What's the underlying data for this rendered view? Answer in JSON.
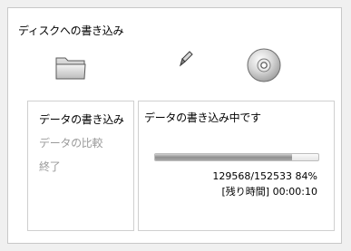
{
  "window": {
    "title": "ディスクへの書き込み"
  },
  "icons": {
    "source": "folder-icon",
    "transfer": "pen-icon",
    "destination": "cd-disc-icon"
  },
  "steps": [
    {
      "label": "データの書き込み",
      "state": "active"
    },
    {
      "label": "データの比較",
      "state": "inactive"
    },
    {
      "label": "終了",
      "state": "inactive"
    }
  ],
  "progress": {
    "status": "データの書き込み中です",
    "counter": "129568/152533 84%",
    "fraction": 0.84,
    "remaining": "[残り時間] 00:00:10"
  },
  "colors": {
    "active_text": "#000000",
    "inactive_text": "#9a9a9a",
    "progress_fill": "#9a9a9a"
  }
}
